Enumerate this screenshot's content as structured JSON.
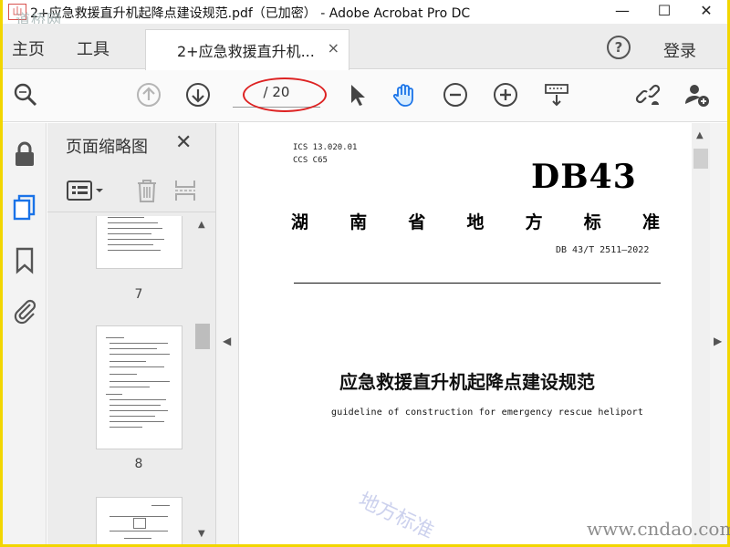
{
  "window": {
    "title": "2+应急救援直升机起降点建设规范.pdf（已加密） - Adobe Acrobat Pro DC",
    "minimize": "—",
    "maximize": "☐",
    "close": "✕",
    "corner_watermark": "道桥网"
  },
  "tabs": {
    "home": "主页",
    "tools": "工具",
    "document": "2+应急救援直升机...",
    "document_close": "×",
    "help": "?",
    "login": "登录"
  },
  "toolbar": {
    "page_indicator": "/ 20",
    "icons": [
      "zoom-icon",
      "page-up-icon",
      "page-down-icon",
      "select-cursor-icon",
      "hand-tool-icon",
      "zoom-out-icon",
      "zoom-in-icon",
      "page-view-icon",
      "share-link-icon",
      "add-user-icon"
    ]
  },
  "thumbnails": {
    "panel_title": "页面缩略图",
    "close": "✕",
    "pages": [
      "7",
      "8"
    ]
  },
  "document": {
    "ics": "ICS  13.020.01",
    "ccs": "CCS  C65",
    "db_label": "DB43",
    "province_chars": [
      "湖",
      "南",
      "省",
      "地",
      "方",
      "标",
      "准"
    ],
    "standard_number": "DB 43/T  2511—2022",
    "title_cn": "应急救援直升机起降点建设规范",
    "title_en": "guideline of construction for emergency rescue heliport"
  },
  "watermarks": {
    "diagonal": "地方标准",
    "site": "www.cndao.com"
  },
  "colors": {
    "frame": "#f2d600",
    "annotation_oval": "#dd2222",
    "accent_blue": "#1a73e8"
  }
}
